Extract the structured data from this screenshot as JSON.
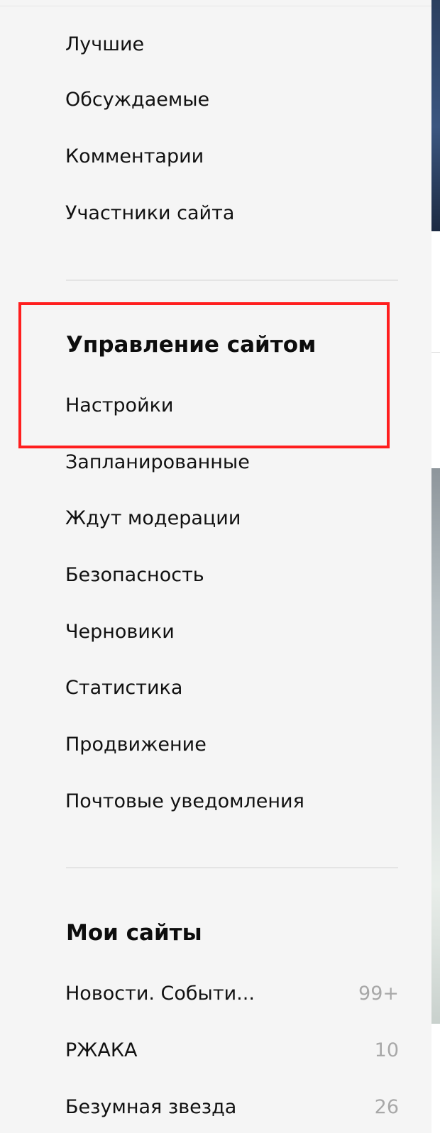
{
  "nav": {
    "items": [
      {
        "label": "Лучшие"
      },
      {
        "label": "Обсуждаемые"
      },
      {
        "label": "Комментарии"
      },
      {
        "label": "Участники сайта"
      }
    ]
  },
  "site_management": {
    "heading": "Управление сайтом",
    "items": [
      {
        "label": "Настройки"
      },
      {
        "label": "Запланированные"
      },
      {
        "label": "Ждут модерации"
      },
      {
        "label": "Безопасность"
      },
      {
        "label": "Черновики"
      },
      {
        "label": "Статистика"
      },
      {
        "label": "Продвижение"
      },
      {
        "label": "Почтовые уведомления"
      }
    ]
  },
  "my_sites": {
    "heading": "Мои сайты",
    "items": [
      {
        "label": "Новости. Событи...",
        "count": "99+"
      },
      {
        "label": "РЖАКА",
        "count": "10"
      },
      {
        "label": "Безумная звезда",
        "count": "26"
      }
    ]
  },
  "annotation": {
    "highlight_color": "#ff1e1e"
  }
}
